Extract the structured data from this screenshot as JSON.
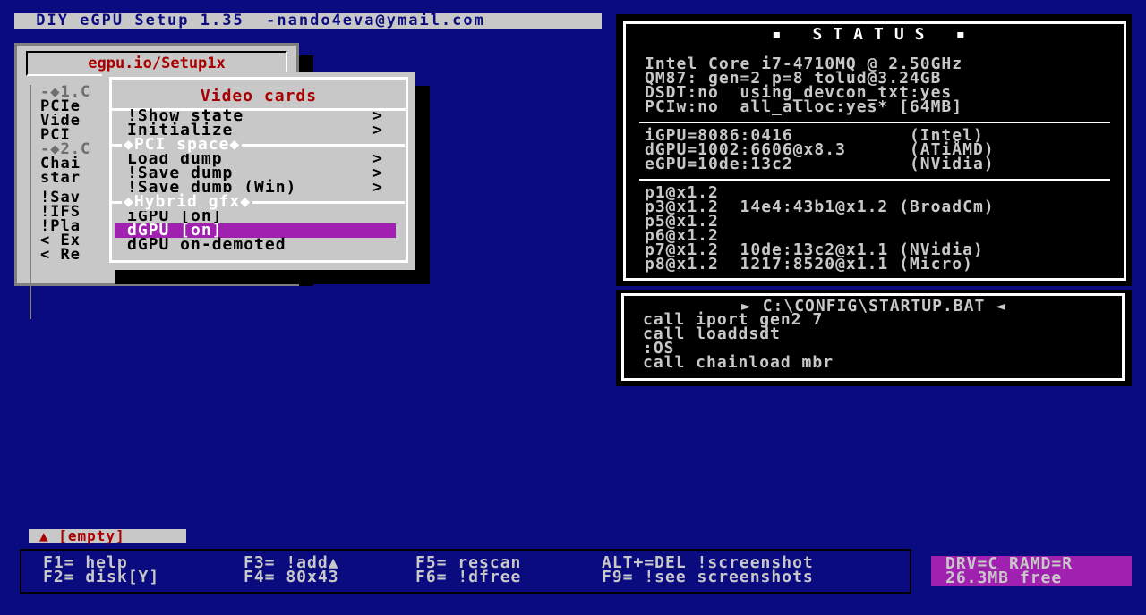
{
  "titlebar": {
    "text": " DIY eGPU Setup 1.35  -nando4eva@ymail.com"
  },
  "back_window": {
    "title": "egpu.io/Setup1x",
    "lines": [
      {
        "text": "-◆1.C",
        "type": "section"
      },
      {
        "text": "PCIe",
        "type": "item"
      },
      {
        "text": "Vide",
        "type": "item"
      },
      {
        "text": "PCI",
        "type": "item"
      },
      {
        "text": "-◆2.C",
        "type": "section"
      },
      {
        "text": "Chai",
        "type": "item"
      },
      {
        "text": "star",
        "type": "item"
      },
      {
        "text": "",
        "type": "sep"
      },
      {
        "text": "!Sav",
        "type": "item"
      },
      {
        "text": "!IFS",
        "type": "item"
      },
      {
        "text": "!Pla",
        "type": "item"
      },
      {
        "text": "< Ex",
        "type": "item"
      },
      {
        "text": "< Re",
        "type": "item"
      }
    ]
  },
  "menu": {
    "title": "Video cards",
    "items": [
      {
        "label": "!Show state",
        "arrow": ">",
        "type": "item"
      },
      {
        "label": "Initialize",
        "arrow": ">",
        "type": "item"
      },
      {
        "label": "◆PCI space◆",
        "arrow": "",
        "type": "section"
      },
      {
        "label": "Load dump",
        "arrow": ">",
        "type": "item"
      },
      {
        "label": "!Save dump",
        "arrow": ">",
        "type": "item"
      },
      {
        "label": "!Save dump (Win)",
        "arrow": ">",
        "type": "item"
      },
      {
        "label": "◆Hybrid gfx◆",
        "arrow": "",
        "type": "section"
      },
      {
        "label": "iGPU [on]",
        "arrow": "",
        "type": "item"
      },
      {
        "label": "dGPU [on]",
        "arrow": "",
        "type": "selected"
      },
      {
        "label": "dGPU on-demoted",
        "arrow": "",
        "type": "item"
      }
    ]
  },
  "status": {
    "title": "▪ STATUS ▪",
    "group1": [
      "Intel Core i7-4710MQ @ 2.50GHz",
      "QM87: gen=2 p=8 tolud@3.24GB",
      "DSDT:no  using_devcon_txt:yes",
      "PCIw:no  all_alloc:yes* [64MB]"
    ],
    "group2": [
      "iGPU=8086:0416           (Intel)",
      "dGPU=1002:6606@x8.3      (ATiÅMD)",
      "eGPU=10de:13c2           (NVidia)"
    ],
    "group3": [
      "p1@x1.2",
      "p3@x1.2  14e4:43b1@x1.2 (BroadCm)",
      "p5@x1.2",
      "p6@x1.2",
      "p7@x1.2  10de:13c2@x1.1 (NVidia)",
      "p8@x1.2  1217:8520@x1.1 (Micro)"
    ]
  },
  "startup": {
    "title": "► C:\\CONFIG\\STARTUP.BAT ◄",
    "lines": [
      "call iport gen2 7",
      "call loaddsdt",
      ":OS",
      "call chainload mbr"
    ]
  },
  "empty_label": "▲ [empty]",
  "fkeys": {
    "col1": [
      "F1= help",
      "F2= disk[Y]"
    ],
    "col2": [
      "F3= !add▲",
      "F4= 80x43"
    ],
    "col3": [
      "F5= rescan",
      "F6= !dfree"
    ],
    "col4": [
      "ALT+=DEL !screenshot",
      "F9= !see screenshots"
    ]
  },
  "drive": {
    "line1": "DRV=C RAMD=R",
    "line2": "26.3MB free"
  },
  "colors": {
    "background": "#0b0b80",
    "panel_gray": "#c8c8c8",
    "title_red": "#a80000",
    "highlight_purple": "#a020b0"
  }
}
